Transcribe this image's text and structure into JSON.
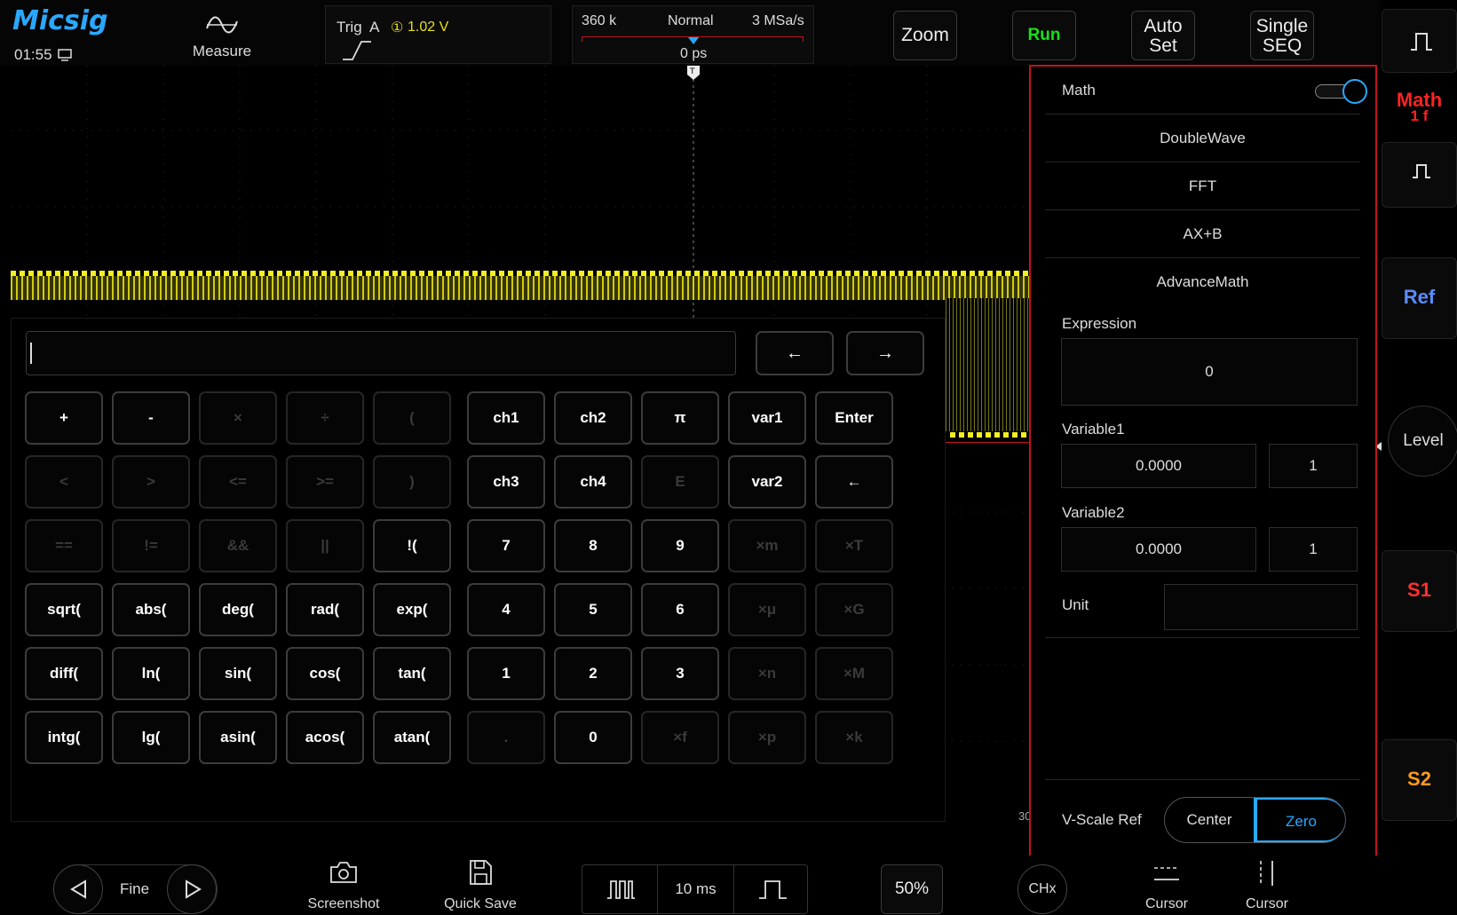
{
  "header": {
    "brand": "Micsig",
    "clock": "01:55",
    "measure_label": "Measure",
    "trig_label": "Trig  A",
    "trig_channel": "①",
    "trig_level": "1.02 V",
    "memory": "360 k",
    "acq_mode": "Normal",
    "sample_rate": "3 MSa/s",
    "time_offset": "0 ps",
    "zoom_label": "Zoom",
    "run_label": "Run",
    "autoset_label_1": "Auto",
    "autoset_label_2": "Set",
    "single_label_1": "Single",
    "single_label_2": "SEQ"
  },
  "side": {
    "math_label": "Math",
    "math_sub": "1 f",
    "ref_label": "Ref",
    "level_label": "Level",
    "s1_label": "S1",
    "s2_label": "S2"
  },
  "panel": {
    "title": "Math",
    "toggle_on": true,
    "items": [
      "DoubleWave",
      "FFT",
      "AX+B",
      "AdvanceMath"
    ],
    "expression_label": "Expression",
    "expression_value": "0",
    "var1_label": "Variable1",
    "var1_value": "0.0000",
    "var1_multiplier": "1",
    "var2_label": "Variable2",
    "var2_value": "0.0000",
    "var2_multiplier": "1",
    "unit_label": "Unit",
    "unit_value": "",
    "vscale_label": "V-Scale Ref",
    "vscale_center": "Center",
    "vscale_zero": "Zero"
  },
  "calculator": {
    "input_value": "",
    "left_arrow": "←",
    "right_arrow": "→",
    "keys": [
      [
        "+",
        "-",
        "×",
        "÷",
        "(",
        "ch1",
        "ch2",
        "π",
        "var1",
        "Enter"
      ],
      [
        "<",
        ">",
        "<=",
        ">=",
        ")",
        "ch3",
        "ch4",
        "E",
        "var2",
        "←"
      ],
      [
        "==",
        "!=",
        "&&",
        "||",
        "!(",
        "7",
        "8",
        "9",
        "×m",
        "×T"
      ],
      [
        "sqrt(",
        "abs(",
        "deg(",
        "rad(",
        "exp(",
        "4",
        "5",
        "6",
        "×μ",
        "×G"
      ],
      [
        "diff(",
        "ln(",
        "sin(",
        "cos(",
        "tan(",
        "1",
        "2",
        "3",
        "×n",
        "×M"
      ],
      [
        "intg(",
        "lg(",
        "asin(",
        "acos(",
        "atan(",
        ".",
        "0",
        "×f",
        "×p",
        "×k"
      ]
    ],
    "dim_keys": [
      "×",
      "÷",
      "(",
      "<",
      ">",
      "<=",
      ">=",
      ")",
      "E",
      "==",
      "!=",
      "&&",
      "||",
      "×m",
      "×T",
      "×μ",
      "×G",
      "×n",
      "×M",
      ".",
      "×f",
      "×p",
      "×k"
    ]
  },
  "bottom": {
    "fine_label": "Fine",
    "screenshot_label": "Screenshot",
    "quicksave_label": "Quick Save",
    "timebase": "10 ms",
    "percent": "50%",
    "chx_label": "CHx",
    "cursor1_label": "Cursor",
    "cursor2_label": "Cursor"
  },
  "colors": {
    "accent": "#2aa8ff",
    "trace": "#e6e014",
    "math_red": "#ff2222",
    "run_green": "#18e018",
    "s1": "#ff3030",
    "s2": "#ff9a1a",
    "ref": "#5a8cff",
    "panel_border": "#c0141c"
  }
}
